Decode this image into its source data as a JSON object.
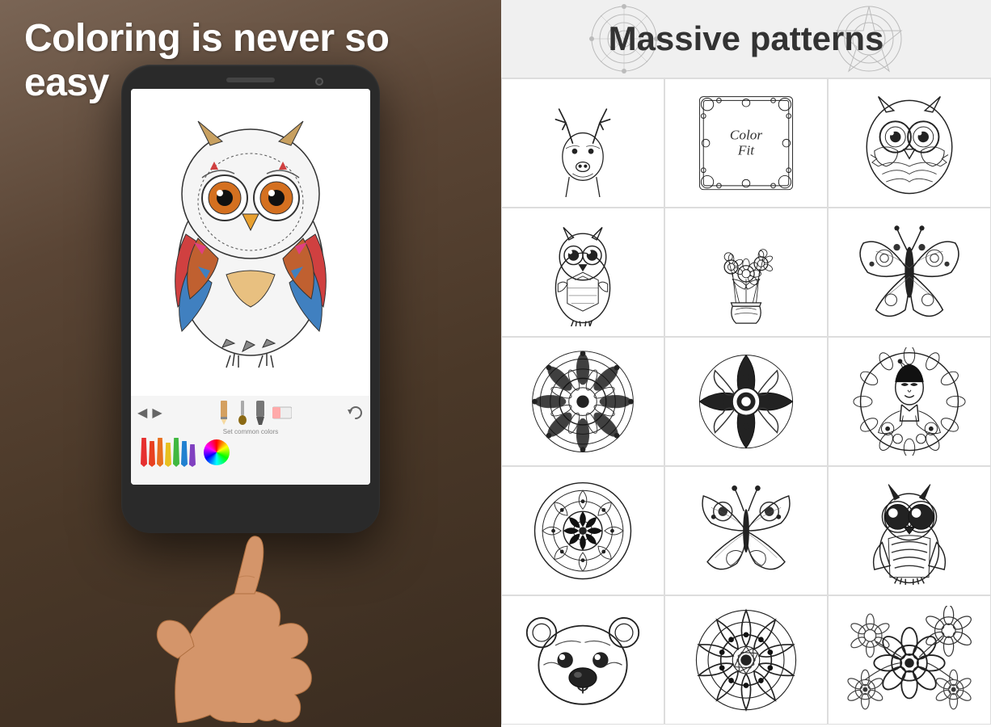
{
  "left_panel": {
    "title": "Coloring is never so easy",
    "subtitle": "Set common colors",
    "colors": [
      "#e63030",
      "#e8a030",
      "#c8c830",
      "#40b840",
      "#2080d0",
      "#8040c0",
      "#d04080"
    ],
    "background_color": "#5a4535"
  },
  "right_panel": {
    "header_title": "Massive patterns",
    "patterns": [
      {
        "id": "header-mandala-left",
        "type": "mandala",
        "label": "Mandala decoration"
      },
      {
        "id": "header-mandala-right",
        "type": "mandala",
        "label": "Mandala decoration"
      },
      {
        "id": "deer",
        "type": "deer",
        "label": "Deer antlers"
      },
      {
        "id": "colorfit-logo",
        "type": "logo",
        "label": "ColorFit logo"
      },
      {
        "id": "owl-head",
        "type": "owl",
        "label": "Owl portrait"
      },
      {
        "id": "small-owl",
        "type": "small-owl",
        "label": "Small owl"
      },
      {
        "id": "flowers",
        "type": "flowers",
        "label": "Flower bouquet"
      },
      {
        "id": "butterfly-right",
        "type": "butterfly",
        "label": "Butterfly right"
      },
      {
        "id": "mandala1",
        "type": "mandala-flower",
        "label": "Mandala flower"
      },
      {
        "id": "mandala2",
        "type": "mandala-ornate",
        "label": "Ornate mandala"
      },
      {
        "id": "geisha",
        "type": "geisha",
        "label": "Geisha circle"
      },
      {
        "id": "mandala3",
        "type": "mandala-round",
        "label": "Round mandala"
      },
      {
        "id": "butterfly-center",
        "type": "butterfly-center",
        "label": "Butterfly center"
      },
      {
        "id": "owl2",
        "type": "owl2",
        "label": "Decorative owl"
      },
      {
        "id": "bear",
        "type": "bear",
        "label": "Bear head"
      },
      {
        "id": "mandala4",
        "type": "mandala4",
        "label": "Lotus mandala"
      },
      {
        "id": "flowers2",
        "type": "flowers2",
        "label": "Flower cluster"
      }
    ]
  }
}
